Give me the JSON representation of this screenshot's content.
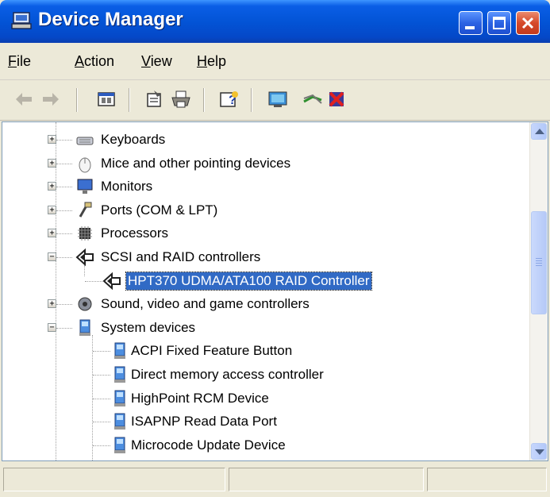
{
  "window": {
    "title": "Device Manager",
    "controls": {
      "minimize": "minimize",
      "maximize": "maximize",
      "close": "close"
    }
  },
  "menu": [
    {
      "label": "File",
      "accel": "F"
    },
    {
      "label": "Action",
      "accel": "A"
    },
    {
      "label": "View",
      "accel": "V"
    },
    {
      "label": "Help",
      "accel": "H"
    }
  ],
  "toolbar": {
    "buttons": [
      {
        "name": "back",
        "icon": "back-arrow-icon"
      },
      {
        "name": "forward",
        "icon": "forward-arrow-icon"
      },
      {
        "name": "show-hide-console-tree",
        "icon": "console-tree-icon"
      },
      {
        "name": "properties",
        "icon": "properties-icon"
      },
      {
        "name": "print",
        "icon": "printer-icon"
      },
      {
        "name": "help",
        "icon": "help-icon"
      },
      {
        "name": "scan-hardware",
        "icon": "scan-hardware-icon"
      },
      {
        "name": "update-driver",
        "icon": "update-driver-icon"
      },
      {
        "name": "uninstall",
        "icon": "uninstall-icon"
      }
    ]
  },
  "tree": {
    "items": [
      {
        "label": "Keyboards",
        "icon": "keyboard-icon",
        "expander": "+"
      },
      {
        "label": "Mice and other pointing devices",
        "icon": "mouse-icon",
        "expander": "+"
      },
      {
        "label": "Monitors",
        "icon": "monitor-icon",
        "expander": "+"
      },
      {
        "label": "Ports (COM & LPT)",
        "icon": "port-icon",
        "expander": "+"
      },
      {
        "label": "Processors",
        "icon": "processor-icon",
        "expander": "+"
      },
      {
        "label": "SCSI and RAID controllers",
        "icon": "scsi-icon",
        "expander": "−"
      },
      {
        "label": "HPT370 UDMA/ATA100 RAID Controller",
        "icon": "scsi-icon",
        "selected": true
      },
      {
        "label": "Sound, video and game controllers",
        "icon": "sound-icon",
        "expander": "+"
      },
      {
        "label": "System devices",
        "icon": "system-device-icon",
        "expander": "−"
      },
      {
        "label": "ACPI Fixed Feature Button",
        "icon": "system-device-icon"
      },
      {
        "label": "Direct memory access controller",
        "icon": "system-device-icon"
      },
      {
        "label": "HighPoint RCM Device",
        "icon": "system-device-icon"
      },
      {
        "label": "ISAPNP Read Data Port",
        "icon": "system-device-icon"
      },
      {
        "label": "Microcode Update Device",
        "icon": "system-device-icon"
      }
    ]
  },
  "scrollbar": {
    "position": 0.35
  },
  "colors": {
    "selection": "#316ac5",
    "titlebar": "#0354d6",
    "chrome": "#ece9d8"
  }
}
